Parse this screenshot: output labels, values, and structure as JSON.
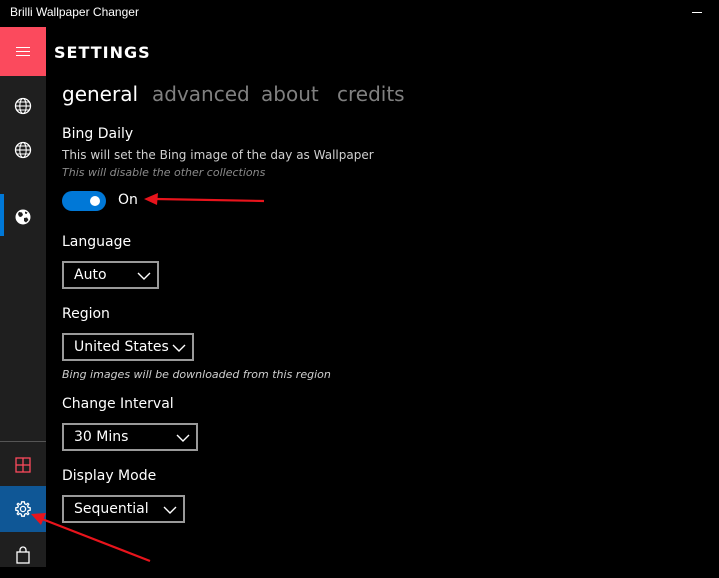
{
  "window": {
    "title": "Brilli Wallpaper Changer"
  },
  "sidebar": {
    "items": [
      {
        "name": "menu",
        "icon": "hamburger-icon"
      },
      {
        "name": "collection-1",
        "icon": "globe-icon"
      },
      {
        "name": "collection-2",
        "icon": "globe-icon"
      },
      {
        "name": "bing",
        "icon": "earth-icon",
        "selected": true
      },
      {
        "name": "tiles",
        "icon": "tiles-icon"
      },
      {
        "name": "settings",
        "icon": "gear-icon",
        "active": true
      },
      {
        "name": "store",
        "icon": "shopping-bag-icon"
      }
    ]
  },
  "page": {
    "title": "SETTINGS",
    "tabs": [
      {
        "label": "general",
        "active": true
      },
      {
        "label": "advanced"
      },
      {
        "label": "about"
      },
      {
        "label": "credits"
      }
    ]
  },
  "general": {
    "bing_daily": {
      "label": "Bing Daily",
      "description": "This will set the Bing image of the day as Wallpaper",
      "note": "This will disable the other collections",
      "toggle_state": "On"
    },
    "language": {
      "label": "Language",
      "value": "Auto"
    },
    "region": {
      "label": "Region",
      "value": "United States",
      "note": "Bing images will be downloaded from this region"
    },
    "change_interval": {
      "label": "Change Interval",
      "value": "30 Mins"
    },
    "display_mode": {
      "label": "Display Mode",
      "value": "Sequential"
    }
  },
  "colors": {
    "accent": "#0078d7",
    "hamburger_bg": "#fb4a5d",
    "annotation_arrow": "#e8141c"
  }
}
